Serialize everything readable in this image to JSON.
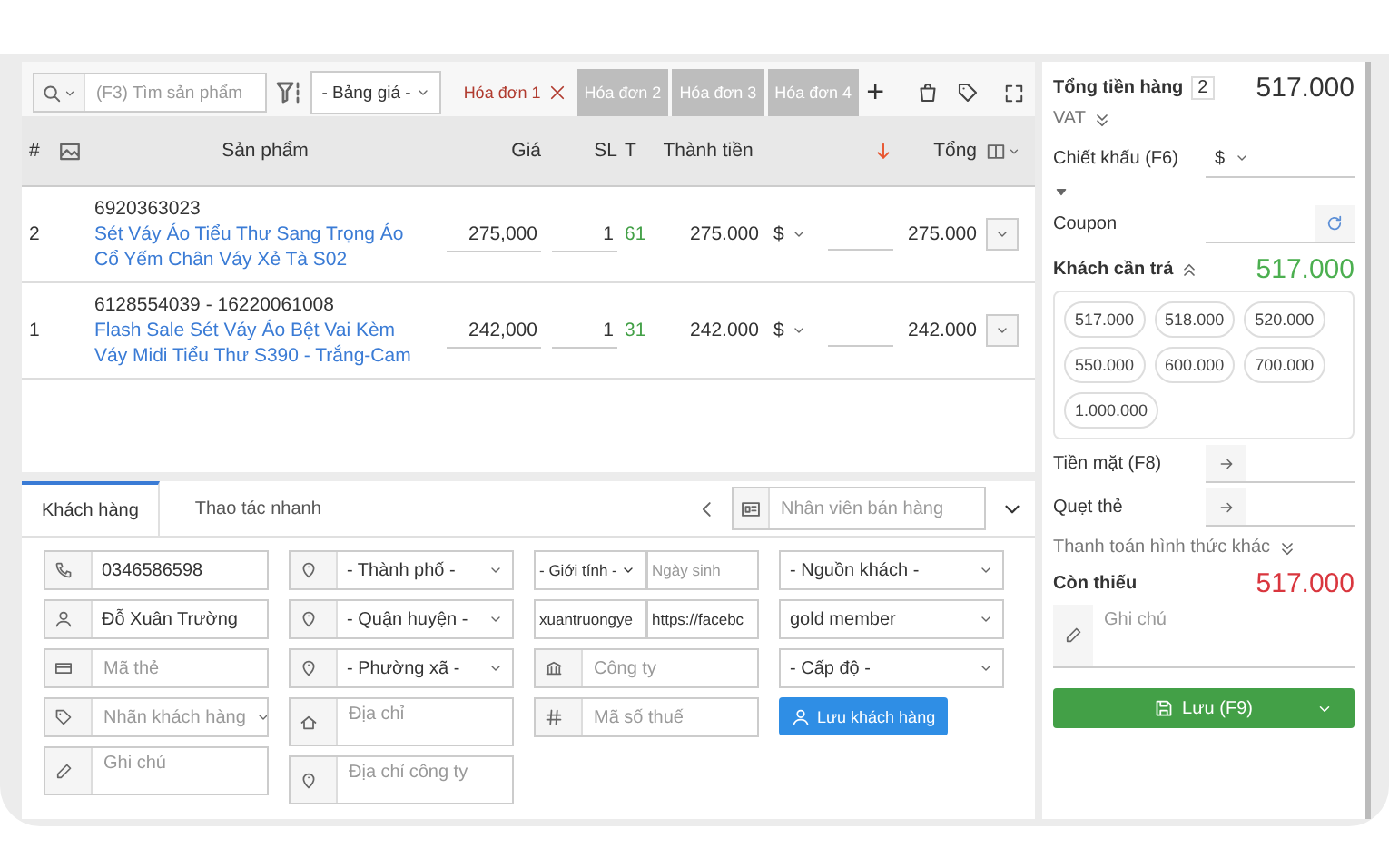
{
  "toolbar": {
    "search_placeholder": "(F3) Tìm sản phẩm",
    "price_list": "- Bảng giá -",
    "add_tab": "+"
  },
  "invoice_tabs": [
    {
      "label": "Hóa đơn 1",
      "selected": true
    },
    {
      "label": "Hóa đơn 2",
      "selected": false
    },
    {
      "label": "Hóa đơn 3",
      "selected": false
    },
    {
      "label": "Hóa đơn 4",
      "selected": false
    }
  ],
  "table": {
    "columns": [
      "#",
      "Sản phẩm",
      "Giá",
      "SL",
      "T",
      "Thành tiền",
      "Tổng"
    ],
    "rows": [
      {
        "index": "2",
        "sku": "6920363023",
        "name": "Sét Váy Áo Tiểu Thư Sang Trọng Áo Cổ Yếm Chân Váy Xẻ Tà S02",
        "price": "275,000",
        "qty": "1",
        "stock": "61",
        "amount": "275.000",
        "discount_unit": "$",
        "total": "275.000"
      },
      {
        "index": "1",
        "sku": "6128554039 - 16220061008",
        "name": "Flash Sale Sét Váy Áo Bệt Vai Kèm Váy Midi Tiểu Thư S390 - Trắng-Cam",
        "price": "242,000",
        "qty": "1",
        "stock": "31",
        "amount": "242.000",
        "discount_unit": "$",
        "total": "242.000"
      }
    ]
  },
  "customer_panel": {
    "tabs": [
      {
        "label": "Khách hàng",
        "selected": true
      },
      {
        "label": "Thao tác nhanh",
        "selected": false
      }
    ],
    "staff_placeholder": "Nhân viên bán hàng",
    "columns": [
      [
        {
          "kind": "input",
          "value": "0346586598"
        },
        {
          "kind": "input",
          "value": "Đỗ Xuân Trường"
        },
        {
          "kind": "input",
          "placeholder": "Mã thẻ"
        },
        {
          "kind": "select",
          "placeholder": "Nhãn khách hàng"
        },
        {
          "kind": "textarea",
          "placeholder": "Ghi chú"
        }
      ],
      [
        {
          "kind": "select",
          "value": "- Thành phố -"
        },
        {
          "kind": "select",
          "value": "- Quận huyện -"
        },
        {
          "kind": "select",
          "value": "- Phường xã -"
        },
        {
          "kind": "textarea",
          "placeholder": "Địa chỉ"
        },
        {
          "kind": "textarea",
          "placeholder": "Địa chỉ công ty"
        }
      ],
      [
        {
          "kind": "pair",
          "parts": [
            {
              "kind": "select",
              "value": "- Giới tính -"
            },
            {
              "kind": "input",
              "placeholder": "Ngày sinh"
            }
          ]
        },
        {
          "kind": "pair",
          "parts": [
            {
              "kind": "input",
              "value": "xuantruongye"
            },
            {
              "kind": "input",
              "value": "https://facebc"
            }
          ]
        },
        {
          "kind": "input",
          "placeholder": "Công ty"
        },
        {
          "kind": "input",
          "placeholder": "Mã số thuế"
        }
      ],
      [
        {
          "kind": "select",
          "value": "- Nguồn khách -"
        },
        {
          "kind": "select",
          "value": "gold member"
        },
        {
          "kind": "select",
          "value": "- Cấp độ -"
        },
        {
          "kind": "button",
          "label": "Lưu khách hàng"
        }
      ]
    ]
  },
  "summary": {
    "subtotal_label": "Tổng tiền hàng",
    "item_count": "2",
    "subtotal": "517.000",
    "vat_label": "VAT",
    "discount_label": "Chiết khấu (F6)",
    "discount_unit": "$",
    "coupon_label": "Coupon",
    "due_label": "Khách cần trả",
    "due": "517.000",
    "quick_amounts": [
      "517.000",
      "518.000",
      "520.000",
      "550.000",
      "600.000",
      "700.000",
      "1.000.000"
    ],
    "payments": [
      "Tiền mặt (F8)",
      "Quẹt thẻ"
    ],
    "other_payment": "Thanh toán hình thức khác",
    "remaining_label": "Còn thiếu",
    "remaining": "517.000",
    "note_placeholder": "Ghi chú",
    "save_button": "Lưu (F9)"
  }
}
